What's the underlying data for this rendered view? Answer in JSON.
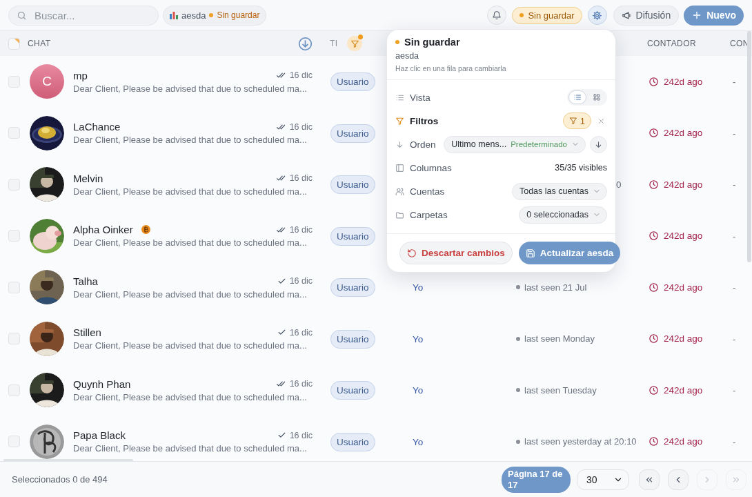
{
  "topbar": {
    "search": {
      "placeholder": "Buscar..."
    },
    "view_chip": {
      "name": "aesda",
      "status": "Sin guardar"
    },
    "unsaved_pill": "Sin guardar",
    "settings_active": true,
    "broadcast_button": "Difusión",
    "new_button": "Nuevo"
  },
  "table": {
    "header": {
      "select_all_partial": true,
      "chat": "CHAT",
      "type": "TI",
      "type_filter_active": true,
      "counter": "CONTADOR",
      "column_7": "CON"
    },
    "rows": [
      {
        "checked": false,
        "avatar": {
          "kind": "letter",
          "letter": "C"
        },
        "name": "mp",
        "emblem": false,
        "read": true,
        "date": "16 dic",
        "preview": "Dear Client, Please be advised that due to scheduled ma...",
        "role": "Usuario",
        "counter": "242d ago",
        "column_7": "-"
      },
      {
        "checked": false,
        "name": "LaChance",
        "emblem": false,
        "read": true,
        "date": "16 dic",
        "preview": "Dear Client, Please be advised that due to scheduled ma...",
        "role": "Usuario",
        "counter": "242d ago",
        "column_7": "-"
      },
      {
        "checked": false,
        "name": "Melvin",
        "emblem": false,
        "read": true,
        "date": "16 dic",
        "preview": "Dear Client, Please be advised that due to scheduled ma...",
        "role": "Usuario",
        "status": {
          "kind": "fragment",
          "text": "0"
        },
        "counter": "242d ago",
        "column_7": "-"
      },
      {
        "checked": false,
        "name": "Alpha Oinker",
        "emblem": true,
        "read": true,
        "date": "16 dic",
        "preview": "Dear Client, Please be advised that due to scheduled ma...",
        "role": "Usuario",
        "counter": "242d ago",
        "column_7": "-"
      },
      {
        "checked": false,
        "name": "Talha",
        "emblem": false,
        "read": false,
        "date": "16 dic",
        "preview": "Dear Client, Please be advised that due to scheduled ma...",
        "role": "Usuario",
        "owner": "Yo",
        "status": {
          "kind": "seen",
          "text": "last seen 21 Jul"
        },
        "counter": "242d ago",
        "column_7": "-"
      },
      {
        "checked": false,
        "name": "Stillen",
        "emblem": false,
        "read": false,
        "date": "16 dic",
        "preview": "Dear Client, Please be advised that due to scheduled ma...",
        "role": "Usuario",
        "owner": "Yo",
        "status": {
          "kind": "seen",
          "text": "last seen Monday"
        },
        "counter": "242d ago",
        "column_7": "-"
      },
      {
        "checked": false,
        "name": "Quynh Phan",
        "emblem": false,
        "read": true,
        "date": "16 dic",
        "preview": "Dear Client, Please be advised that due to scheduled ma...",
        "role": "Usuario",
        "owner": "Yo",
        "status": {
          "kind": "seen",
          "text": "last seen Tuesday"
        },
        "counter": "242d ago",
        "column_7": "-"
      },
      {
        "checked": false,
        "name": "Papa Black",
        "emblem": false,
        "read": false,
        "date": "16 dic",
        "preview": "Dear Client, Please be advised that due to scheduled ma...",
        "role": "Usuario",
        "owner": "Yo",
        "status": {
          "kind": "seen",
          "text": "last seen yesterday at 20:10"
        },
        "counter": "242d ago",
        "column_7": "-"
      }
    ]
  },
  "popover": {
    "title": "Sin guardar",
    "view_name": "aesda",
    "hint": "Haz clic en una fila para cambiarla",
    "rows": [
      {
        "kind": "view",
        "label": "Vista",
        "options": [
          {
            "kind": "list",
            "selected": true
          },
          {
            "kind": "grid",
            "selected": false
          }
        ]
      },
      {
        "kind": "filters",
        "label": "Filtros",
        "active": true,
        "count": "1"
      },
      {
        "kind": "sort",
        "label": "Orden",
        "field": "Ultimo mens...",
        "tag": "Predeterminado"
      },
      {
        "kind": "columns",
        "label": "Columnas",
        "value": "35/35 visibles"
      },
      {
        "kind": "accounts",
        "label": "Cuentas",
        "value": "Todas las cuentas"
      },
      {
        "kind": "folders",
        "label": "Carpetas",
        "value": "0 seleccionadas"
      }
    ],
    "discard_button": "Descartar cambios",
    "update_button": "Actualizar aesda"
  },
  "footer": {
    "selection": "Seleccionados 0 de 494",
    "page_label": "Página 17 de 17",
    "page_size": "30",
    "nav": [
      {
        "kind": "first",
        "disabled": false
      },
      {
        "kind": "prev",
        "disabled": false
      },
      {
        "kind": "next",
        "disabled": true
      },
      {
        "kind": "last",
        "disabled": true
      }
    ]
  }
}
